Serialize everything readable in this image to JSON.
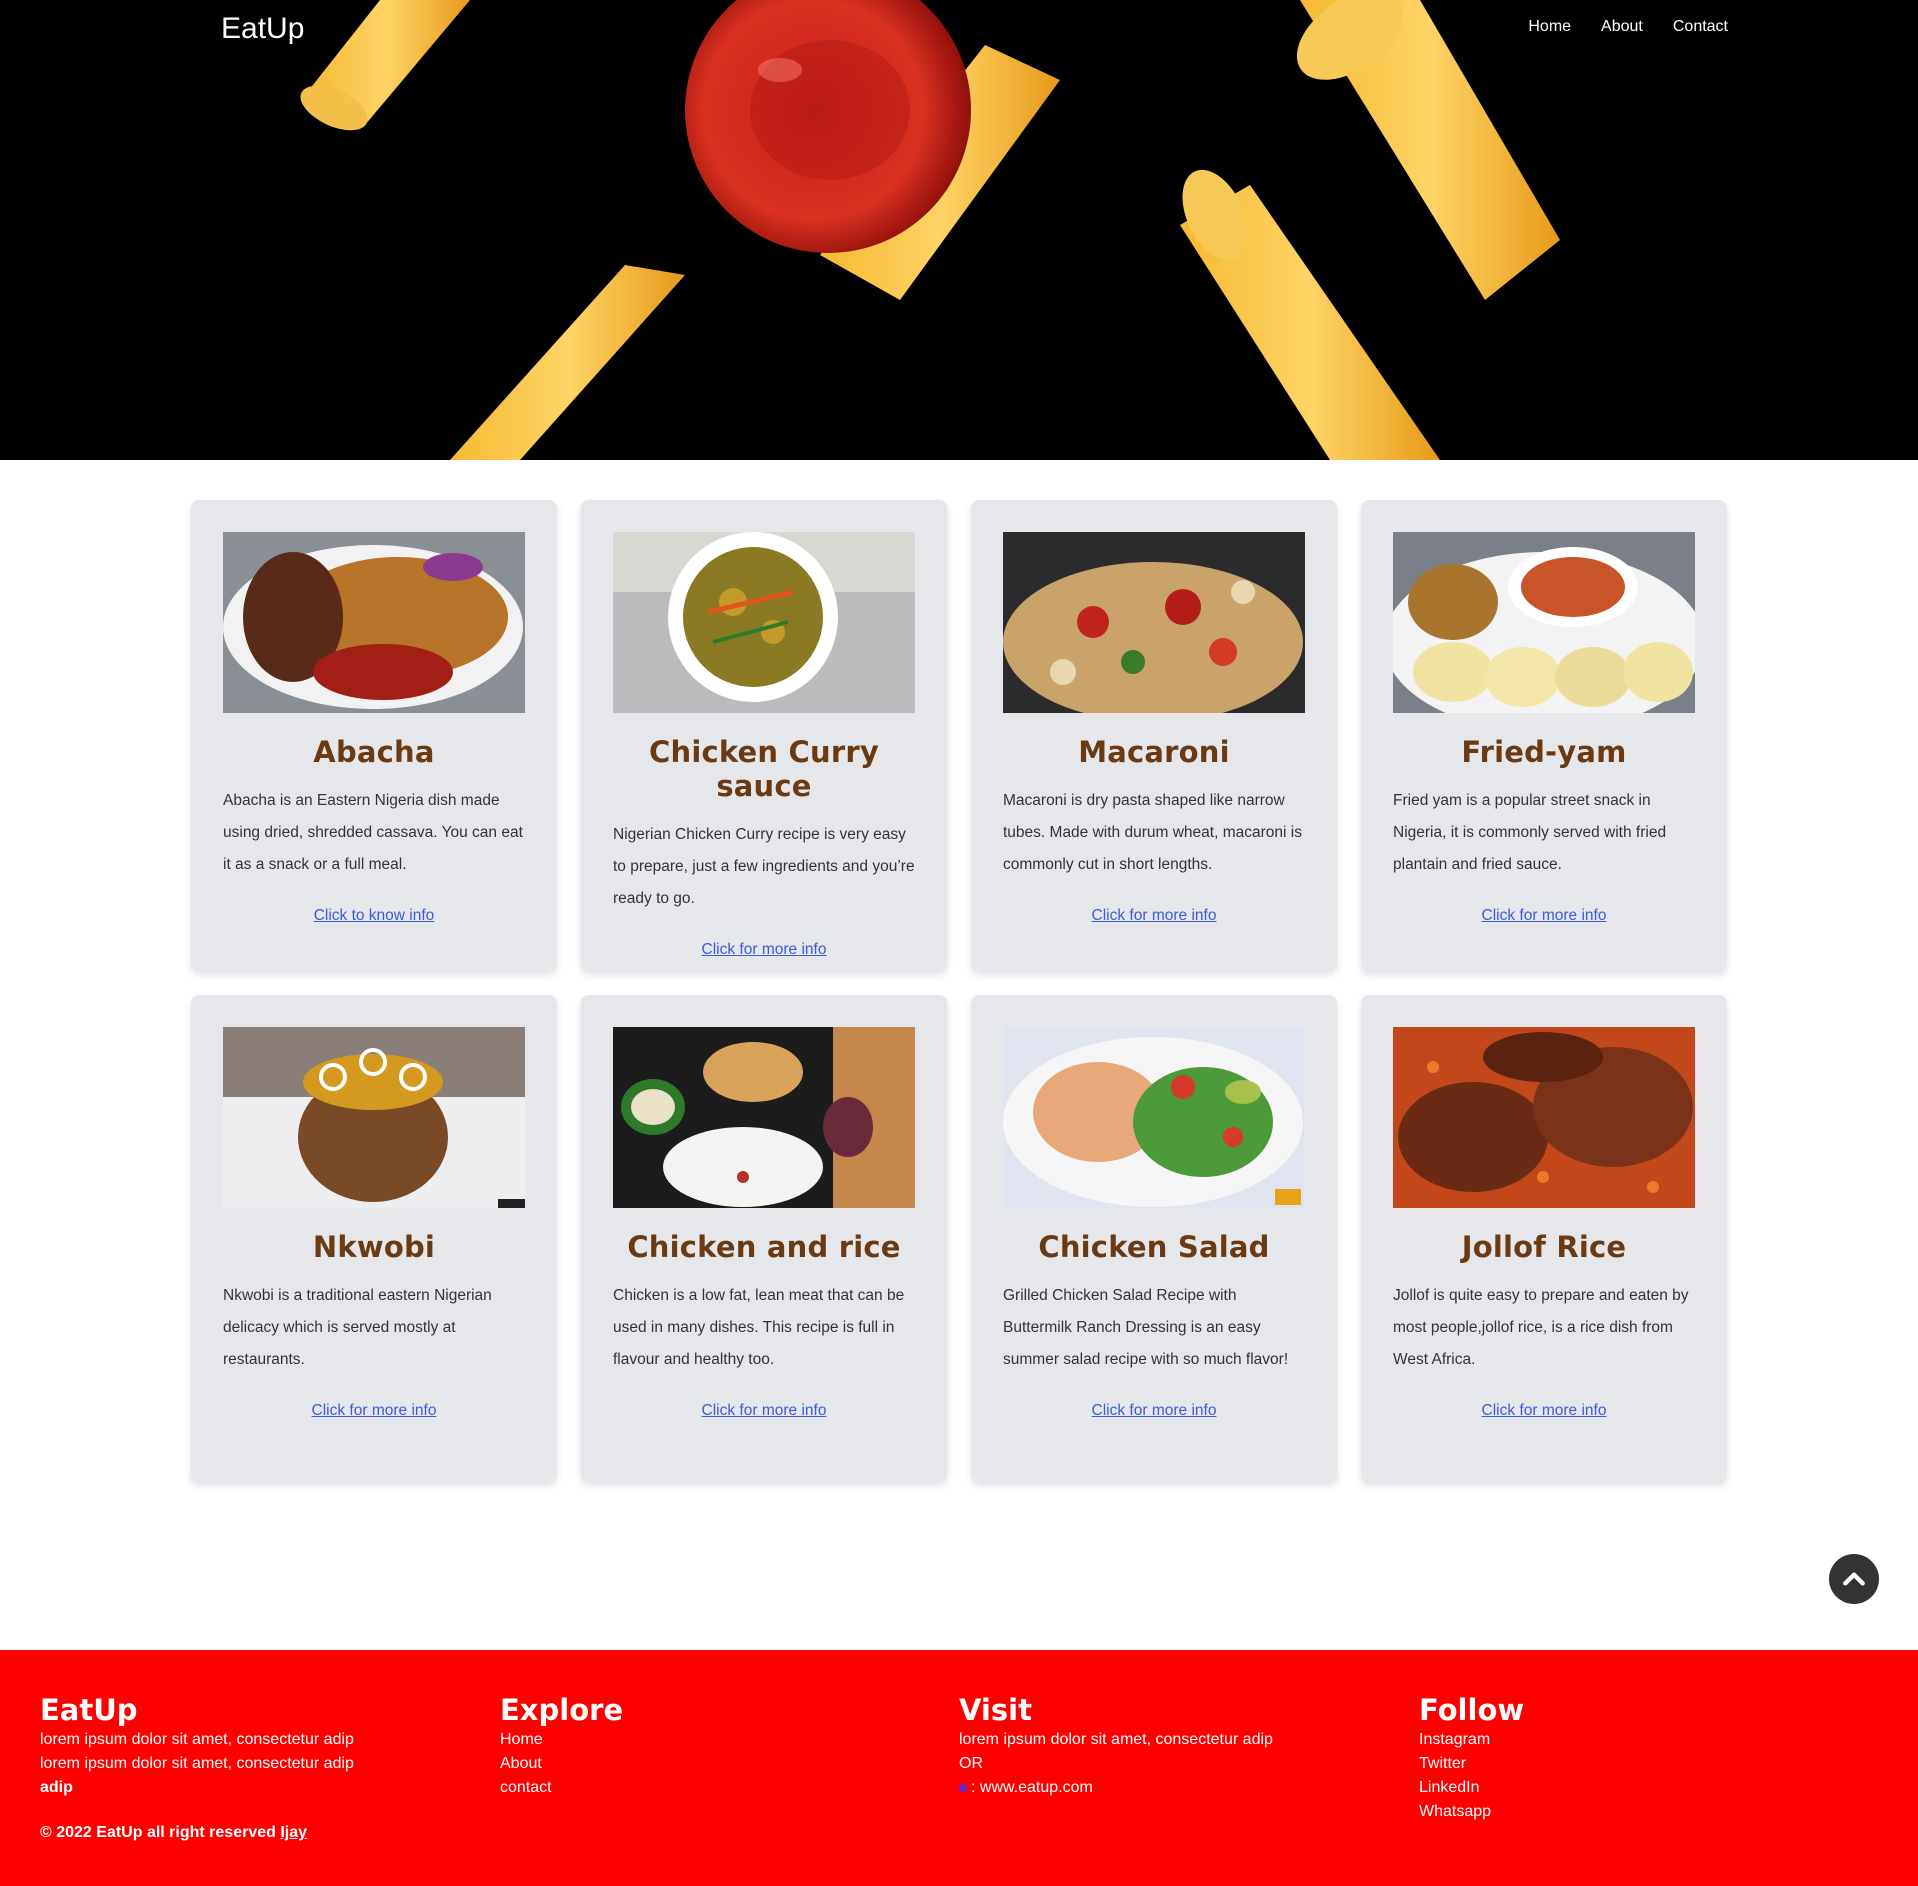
{
  "header": {
    "logo": "EatUp",
    "nav": [
      "Home",
      "About",
      "Contact"
    ]
  },
  "cards": [
    {
      "title": "Abacha",
      "text": "Abacha is an Eastern Nigeria dish made using dried, shredded cassava. You can eat it as a snack or a full meal.",
      "link": "Click to know info"
    },
    {
      "title": "Chicken Curry sauce",
      "text": "Nigerian Chicken Curry recipe is very easy to prepare, just a few ingredients and you’re ready to go.",
      "link": "Click for more info"
    },
    {
      "title": "Macaroni",
      "text": "Macaroni is dry pasta shaped like narrow tubes. Made with durum wheat, macaroni is commonly cut in short lengths.",
      "link": "Click for more info"
    },
    {
      "title": "Fried-yam",
      "text": "Fried yam is a popular street snack in Nigeria, it is commonly served with fried plantain and fried sauce.",
      "link": "Click for more info"
    },
    {
      "title": "Nkwobi",
      "text": "Nkwobi is a traditional eastern Nigerian delicacy which is served mostly at restaurants.",
      "link": "Click for more info"
    },
    {
      "title": "Chicken and rice",
      "text": "Chicken is a low fat, lean meat that can be used in many dishes. This recipe is full in flavour and healthy too.",
      "link": "Click for more info"
    },
    {
      "title": "Chicken Salad",
      "text": "Grilled Chicken Salad Recipe with Buttermilk Ranch Dressing is an easy summer salad recipe with so much flavor!",
      "link": "Click for more info"
    },
    {
      "title": "Jollof Rice",
      "text": "Jollof is quite easy to prepare and eaten by most people,jollof rice, is a rice dish from West Africa.",
      "link": "Click for more info"
    }
  ],
  "footer": {
    "brand": {
      "title": "EatUp",
      "line1": "lorem ipsum dolor sit amet, consectetur adip",
      "line2": "lorem ipsum dolor sit amet, consectetur adip",
      "line3": "adip"
    },
    "explore": {
      "title": "Explore",
      "links": [
        "Home",
        "About",
        "contact"
      ]
    },
    "visit": {
      "title": "Visit",
      "line1": "lorem ipsum dolor sit amet, consectetur adip",
      "line2": "OR",
      "line3": ": www.eatup.com"
    },
    "follow": {
      "title": "Follow",
      "links": [
        "Instagram",
        "Twitter",
        "LinkedIn",
        "Whatsapp"
      ]
    },
    "copyright_prefix": "© 2022 EatUp all right reserved ",
    "copyright_author": "Ijay"
  },
  "colors": {
    "footer_bg": "#ff0000",
    "card_bg": "#e5e7eb",
    "title": "#6b3a12",
    "link": "#3b5bdb"
  },
  "icons": {
    "scroll_top": "chevron-up-icon"
  }
}
